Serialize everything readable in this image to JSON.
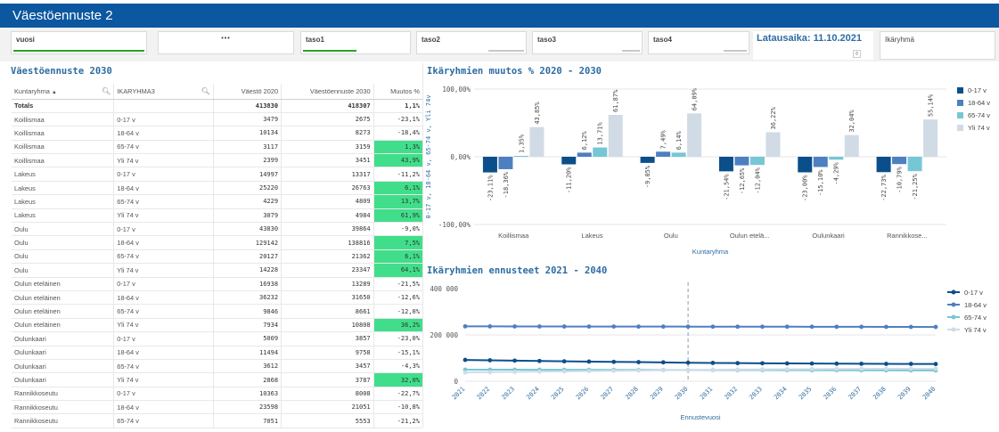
{
  "app": {
    "title": "Väestöennuste 2"
  },
  "filters": {
    "vuosi": "vuosi",
    "more": "•••",
    "taso1": "taso1",
    "taso2": "taso2",
    "taso3": "taso3",
    "taso4": "taso4",
    "latausaika": "Latausaika: 11.10.2021",
    "scroll_glyph": "◊",
    "ikaryhma": "Ikäryhmä"
  },
  "table": {
    "title": "Väestöennuste 2030",
    "headers": {
      "kuntaryhma": "Kuntaryhma",
      "ikaryhma": "IKARYHMA3",
      "vaesto": "Väestö 2020",
      "ennuste": "Väestöennuste 2030",
      "muutos": "Muutos %"
    },
    "totals": {
      "label": "Totals",
      "vaesto": "413830",
      "ennuste": "418307",
      "muutos": "1,1%"
    },
    "rows": [
      {
        "k": "Koillismaa",
        "i": "0-17 v",
        "v": "3479",
        "e": "2675",
        "m": "-23,1%",
        "pos": false
      },
      {
        "k": "Koillismaa",
        "i": "18-64 v",
        "v": "10134",
        "e": "8273",
        "m": "-18,4%",
        "pos": false
      },
      {
        "k": "Koillismaa",
        "i": "65-74 v",
        "v": "3117",
        "e": "3159",
        "m": "1,3%",
        "pos": true
      },
      {
        "k": "Koillismaa",
        "i": "Yli 74 v",
        "v": "2399",
        "e": "3451",
        "m": "43,9%",
        "pos": true
      },
      {
        "k": "Lakeus",
        "i": "0-17 v",
        "v": "14997",
        "e": "13317",
        "m": "-11,2%",
        "pos": false
      },
      {
        "k": "Lakeus",
        "i": "18-64 v",
        "v": "25220",
        "e": "26763",
        "m": "6,1%",
        "pos": true
      },
      {
        "k": "Lakeus",
        "i": "65-74 v",
        "v": "4229",
        "e": "4809",
        "m": "13,7%",
        "pos": true
      },
      {
        "k": "Lakeus",
        "i": "Yli 74 v",
        "v": "3079",
        "e": "4984",
        "m": "61,9%",
        "pos": true
      },
      {
        "k": "Oulu",
        "i": "0-17 v",
        "v": "43830",
        "e": "39864",
        "m": "-9,0%",
        "pos": false
      },
      {
        "k": "Oulu",
        "i": "18-64 v",
        "v": "129142",
        "e": "138816",
        "m": "7,5%",
        "pos": true
      },
      {
        "k": "Oulu",
        "i": "65-74 v",
        "v": "20127",
        "e": "21362",
        "m": "6,1%",
        "pos": true
      },
      {
        "k": "Oulu",
        "i": "Yli 74 v",
        "v": "14228",
        "e": "23347",
        "m": "64,1%",
        "pos": true
      },
      {
        "k": "Oulun eteläinen",
        "i": "0-17 v",
        "v": "16938",
        "e": "13289",
        "m": "-21,5%",
        "pos": false
      },
      {
        "k": "Oulun eteläinen",
        "i": "18-64 v",
        "v": "36232",
        "e": "31650",
        "m": "-12,6%",
        "pos": false
      },
      {
        "k": "Oulun eteläinen",
        "i": "65-74 v",
        "v": "9846",
        "e": "8661",
        "m": "-12,0%",
        "pos": false
      },
      {
        "k": "Oulun eteläinen",
        "i": "Yli 74 v",
        "v": "7934",
        "e": "10808",
        "m": "36,2%",
        "pos": true
      },
      {
        "k": "Oulunkaari",
        "i": "0-17 v",
        "v": "5009",
        "e": "3857",
        "m": "-23,0%",
        "pos": false
      },
      {
        "k": "Oulunkaari",
        "i": "18-64 v",
        "v": "11494",
        "e": "9758",
        "m": "-15,1%",
        "pos": false
      },
      {
        "k": "Oulunkaari",
        "i": "65-74 v",
        "v": "3612",
        "e": "3457",
        "m": "-4,3%",
        "pos": false
      },
      {
        "k": "Oulunkaari",
        "i": "Yli 74 v",
        "v": "2868",
        "e": "3787",
        "m": "32,0%",
        "pos": true
      },
      {
        "k": "Rannikkoseutu",
        "i": "0-17 v",
        "v": "10363",
        "e": "8008",
        "m": "-22,7%",
        "pos": false
      },
      {
        "k": "Rannikkoseutu",
        "i": "18-64 v",
        "v": "23598",
        "e": "21051",
        "m": "-10,8%",
        "pos": false
      },
      {
        "k": "Rannikkoseutu",
        "i": "65-74 v",
        "v": "7051",
        "e": "5553",
        "m": "-21,2%",
        "pos": false
      }
    ]
  },
  "colors": {
    "s1": "#0b4f8a",
    "s2": "#4e7fc0",
    "s3": "#76c7d6",
    "s4": "#d0dbe6",
    "positive_cell": "#40de8a",
    "title": "#2d6ca2",
    "header": "#0b57a0"
  },
  "chart_data": [
    {
      "type": "bar",
      "title": "Ikäryhmien muutos % 2020 - 2030",
      "xlabel": "Kuntaryhma",
      "ylabel": "0-17 v, 18-64 v, 65-74 v, Yli 74v",
      "categories": [
        "Koillismaa",
        "Lakeus",
        "Oulu",
        "Oulun etelä...",
        "Oulunkaari",
        "Rannikkose..."
      ],
      "ylim": [
        -100,
        100
      ],
      "yticks": [
        "100,00%",
        "0,00%",
        "-100,00%"
      ],
      "legend_position": "right",
      "series": [
        {
          "name": "0-17 v",
          "values": [
            -23.11,
            -11.2,
            -9.05,
            -21.54,
            -23.0,
            -22.73
          ],
          "labels": [
            "-23,11%",
            "-11,20%",
            "-9,05%",
            "-21,54%",
            "-23,00%",
            "-22,73%"
          ]
        },
        {
          "name": "18-64 v",
          "values": [
            -18.36,
            6.12,
            7.49,
            -12.65,
            -15.1,
            -10.79
          ],
          "labels": [
            "-18,36%",
            "6,12%",
            "7,49%",
            "-12,65%",
            "-15,10%",
            "-10,79%"
          ]
        },
        {
          "name": "65-74 v",
          "values": [
            1.35,
            13.71,
            6.14,
            -12.04,
            -4.29,
            -21.25
          ],
          "labels": [
            "1,35%",
            "13,71%",
            "6,14%",
            "-12,04%",
            "-4,29%",
            "-21,25%"
          ]
        },
        {
          "name": "Yli 74 v",
          "values": [
            43.85,
            61.87,
            64.09,
            36.22,
            32.04,
            55.14
          ],
          "labels": [
            "43,85%",
            "61,87%",
            "64,09%",
            "36,22%",
            "32,04%",
            "55,14%"
          ]
        }
      ]
    },
    {
      "type": "line",
      "title": "Ikäryhmien ennusteet 2021 - 2040",
      "xlabel": "Ennustevuosi",
      "ylabel": "",
      "x": [
        "2021",
        "2022",
        "2023",
        "2024",
        "2025",
        "2026",
        "2027",
        "2028",
        "2029",
        "2030",
        "2031",
        "2032",
        "2033",
        "2034",
        "2035",
        "2036",
        "2037",
        "2038",
        "2039",
        "2040"
      ],
      "ylim": [
        0,
        400000
      ],
      "yticks": [
        "400 000",
        "200 000",
        "0"
      ],
      "marker_year": "2030",
      "legend_position": "right",
      "series": [
        {
          "name": "0-17 v",
          "values": [
            92000,
            90500,
            89000,
            87500,
            86000,
            84800,
            83600,
            82500,
            81400,
            80000,
            79000,
            78200,
            77500,
            76900,
            76300,
            75800,
            75400,
            75000,
            74700,
            74400
          ]
        },
        {
          "name": "18-64 v",
          "values": [
            237000,
            236800,
            236600,
            236500,
            236300,
            236200,
            236100,
            236000,
            235900,
            235800,
            235700,
            235600,
            235500,
            235400,
            235300,
            235100,
            234900,
            234700,
            234500,
            234300
          ]
        },
        {
          "name": "65-74 v",
          "values": [
            50000,
            49900,
            49800,
            49700,
            49500,
            49300,
            49100,
            48900,
            48700,
            48500,
            48300,
            48100,
            47900,
            47700,
            47500,
            47300,
            47100,
            46900,
            46700,
            46500
          ]
        },
        {
          "name": "Yli 74 v",
          "values": [
            38000,
            39200,
            40400,
            41600,
            42800,
            44000,
            45200,
            46300,
            47400,
            48500,
            49500,
            50400,
            51200,
            51900,
            52500,
            53000,
            53400,
            53700,
            53900,
            54000
          ]
        }
      ]
    }
  ]
}
